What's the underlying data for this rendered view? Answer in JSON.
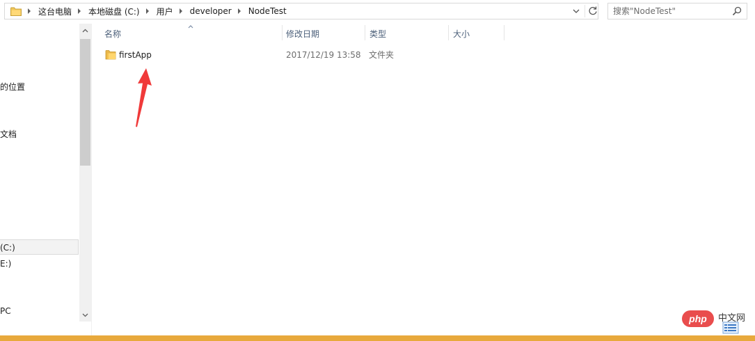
{
  "address_bar": {
    "breadcrumbs": [
      "这台电脑",
      "本地磁盘 (C:)",
      "用户",
      "developer",
      "NodeTest"
    ],
    "icons": {
      "folder": "folder-icon",
      "dropdown": "chevron-down-icon",
      "refresh": "refresh-icon"
    }
  },
  "search": {
    "placeholder": "搜索\"NodeTest\"",
    "icon": "search-icon"
  },
  "nav_pane": {
    "items": [
      {
        "label": "的位置"
      },
      {
        "label": "文档"
      },
      {
        "label": "(C:)",
        "selected": true
      },
      {
        "label": "E:)"
      },
      {
        "label": "PC"
      }
    ]
  },
  "columns": {
    "name": "名称",
    "date": "修改日期",
    "type": "类型",
    "size": "大小"
  },
  "files": [
    {
      "name": "firstApp",
      "date": "2017/12/19 13:58",
      "type": "文件夹",
      "size": "",
      "icon": "folder-icon"
    }
  ],
  "annotation": {
    "icon": "red-arrow-icon",
    "color": "#f03a3a"
  },
  "watermark": {
    "brand": "php",
    "text": "中文网"
  },
  "colors": {
    "header_text": "#4c607a",
    "accent_strip": "#e8a93c",
    "brand_red": "#e94d4d"
  }
}
